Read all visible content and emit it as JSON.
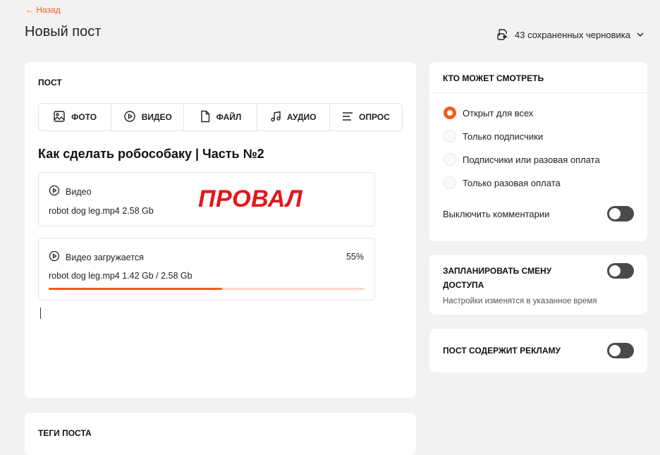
{
  "nav": {
    "back_label": "← Назад"
  },
  "page": {
    "title": "Новый пост"
  },
  "drafts": {
    "label": "43 сохраненных черновика",
    "icon": "draft-icon"
  },
  "post": {
    "section_label": "ПОСТ",
    "toolbar": [
      {
        "label": "ФОТО",
        "icon": "photo-icon"
      },
      {
        "label": "ВИДЕО",
        "icon": "video-icon"
      },
      {
        "label": "ФАЙЛ",
        "icon": "file-icon"
      },
      {
        "label": "АУДИО",
        "icon": "audio-icon"
      },
      {
        "label": "ОПРОС",
        "icon": "poll-icon"
      }
    ],
    "heading": "Как сделать робособаку | Часть №2",
    "overlay_text": "ПРОВАЛ",
    "attachments": [
      {
        "title": "Видео",
        "file": "robot dog leg.mp4  2.58 Gb"
      },
      {
        "title": "Видео загружается",
        "file": "robot dog leg.mp4  1.42 Gb / 2.58 Gb",
        "percent_label": "55%",
        "progress": 0.55
      }
    ]
  },
  "tags": {
    "section_label": "ТЕГИ ПОСТА"
  },
  "visibility": {
    "title": "КТО МОЖЕТ СМОТРЕТЬ",
    "options": [
      {
        "label": "Открыт для всех",
        "selected": true
      },
      {
        "label": "Только подписчики",
        "selected": false
      },
      {
        "label": "Подписчики или разовая оплата",
        "selected": false
      },
      {
        "label": "Только разовая оплата",
        "selected": false
      }
    ],
    "comments_toggle_label": "Выключить комментарии"
  },
  "schedule": {
    "title": "ЗАПЛАНИРОВАТЬ СМЕНУ ДОСТУПА",
    "note": "Настройки изменятся в указанное время"
  },
  "ads": {
    "title": "ПОСТ СОДЕРЖИТ РЕКЛАМУ"
  },
  "colors": {
    "accent": "#f15a24",
    "fail_text": "#e3161b",
    "toggle_off": "#4a4a4a"
  }
}
